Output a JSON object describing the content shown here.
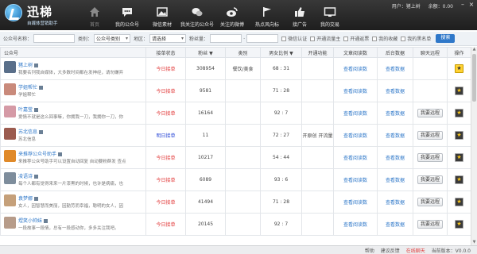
{
  "header": {
    "logo_title": "迅梯",
    "logo_subtitle": "自媒体营销助手",
    "nav": [
      {
        "label": "首页",
        "icon": "home-icon"
      },
      {
        "label": "我的公众号",
        "icon": "chat-icon"
      },
      {
        "label": "微信素材",
        "icon": "picture-icon"
      },
      {
        "label": "我关注的公众号",
        "icon": "wechat-icon"
      },
      {
        "label": "关注的微博",
        "icon": "weibo-icon"
      },
      {
        "label": "热点风向标",
        "icon": "flag-icon"
      },
      {
        "label": "接广告",
        "icon": "thumb-up-icon"
      },
      {
        "label": "我的交易",
        "icon": "ad-icon"
      }
    ],
    "user_label": "用户：猪上树",
    "balance_label": "余额：0.00"
  },
  "search": {
    "account_label": "公众号名称：",
    "account_value": "",
    "category_label": "类别：",
    "category_value": "公众号类别",
    "region_label": "地区：",
    "region_value": "请选择",
    "fans_label": "粉丝量：",
    "fans_min": "",
    "fans_max": "",
    "checkboxes": [
      "微信认证",
      "开通流量主",
      "开通返票",
      "我的收藏",
      "我的黑名单"
    ],
    "search_button": "搜索"
  },
  "table": {
    "columns": [
      "公众号",
      "接单状态",
      "粉丝 ▼",
      "类别",
      "男女比例 ▼",
      "开通功能",
      "文章阅读数",
      "后台数据",
      "聊天远程",
      "操作"
    ],
    "rows": [
      {
        "name": "猪上树",
        "desc": "我要名列我自媒体，大多数时间都在发神经，请勿嫌弃",
        "status": "今日接单",
        "status_type": "red",
        "fans": "308954",
        "category": "餐饮/美食",
        "ratio": "68 : 31",
        "features": "",
        "read": "查看阅读数",
        "backend": "查看数据",
        "remote": "",
        "star": "hl"
      },
      {
        "name": "学姐帮忙",
        "desc": "学姐帮忙",
        "status": "今日接单",
        "status_type": "red",
        "fans": "9581",
        "category": "",
        "ratio": "71 : 28",
        "features": "",
        "read": "查看阅读数",
        "backend": "查看数据",
        "remote": "",
        "star": "dark"
      },
      {
        "name": "叶嘉莹",
        "desc": "爱情不就是这么回事嘛，你拥我一刀，我拥你一刀，你",
        "status": "今日接单",
        "status_type": "red",
        "fans": "16164",
        "category": "",
        "ratio": "92 : 7",
        "features": "",
        "read": "查看阅读数",
        "backend": "查看数据",
        "remote": "我要远程",
        "star": "dark"
      },
      {
        "name": "苏北信息",
        "desc": "苏北信息",
        "status": "明日接单",
        "status_type": "blue",
        "fans": "11",
        "category": "",
        "ratio": "72 : 27",
        "features": "开原创 开流量",
        "read": "查看阅读数",
        "backend": "查看数据",
        "remote": "我要远程",
        "star": "dark"
      },
      {
        "name": "来推荐公众号助手",
        "desc": "来推荐公众号助手可以设置自动回复 自动要粉群发 查点",
        "status": "今日接单",
        "status_type": "red",
        "fans": "10217",
        "category": "",
        "ratio": "54 : 44",
        "features": "",
        "read": "查看阅读数",
        "backend": "查看数据",
        "remote": "我要远程",
        "star": "dark"
      },
      {
        "name": "凌语诗",
        "desc": "每个人都有觉得来来一片漆黑的时候，也许是病痛，也",
        "status": "今日接单",
        "status_type": "red",
        "fans": "6089",
        "category": "",
        "ratio": "93 : 6",
        "features": "",
        "read": "查看阅读数",
        "backend": "查看数据",
        "remote": "我要远程",
        "star": "dark"
      },
      {
        "name": "袁梦娜",
        "desc": "女人，因智慧而美丽，因勤劳而幸福，聪明的女人，因",
        "status": "今日接单",
        "status_type": "red",
        "fans": "41494",
        "category": "",
        "ratio": "71 : 28",
        "features": "",
        "read": "查看阅读数",
        "backend": "查看数据",
        "remote": "我要远程",
        "star": "dark"
      },
      {
        "name": "煜笑小帅妹",
        "desc": "一段故事一段情，总有一段感动你，多多关注我吧。",
        "status": "今日接单",
        "status_type": "red",
        "fans": "20145",
        "category": "",
        "ratio": "92 : 7",
        "features": "",
        "read": "查看阅读数",
        "backend": "查看数据",
        "remote": "我要远程",
        "star": "dark"
      }
    ]
  },
  "statusbar": {
    "help": "帮助",
    "feedback": "建议反馈",
    "online": "在线聊天",
    "version": "当前版本：V0.0.0"
  },
  "colors": {
    "accent": "#2f78c9",
    "status_red": "#e23b3b",
    "status_blue": "#2a48d6",
    "header_bg": "#262626"
  }
}
